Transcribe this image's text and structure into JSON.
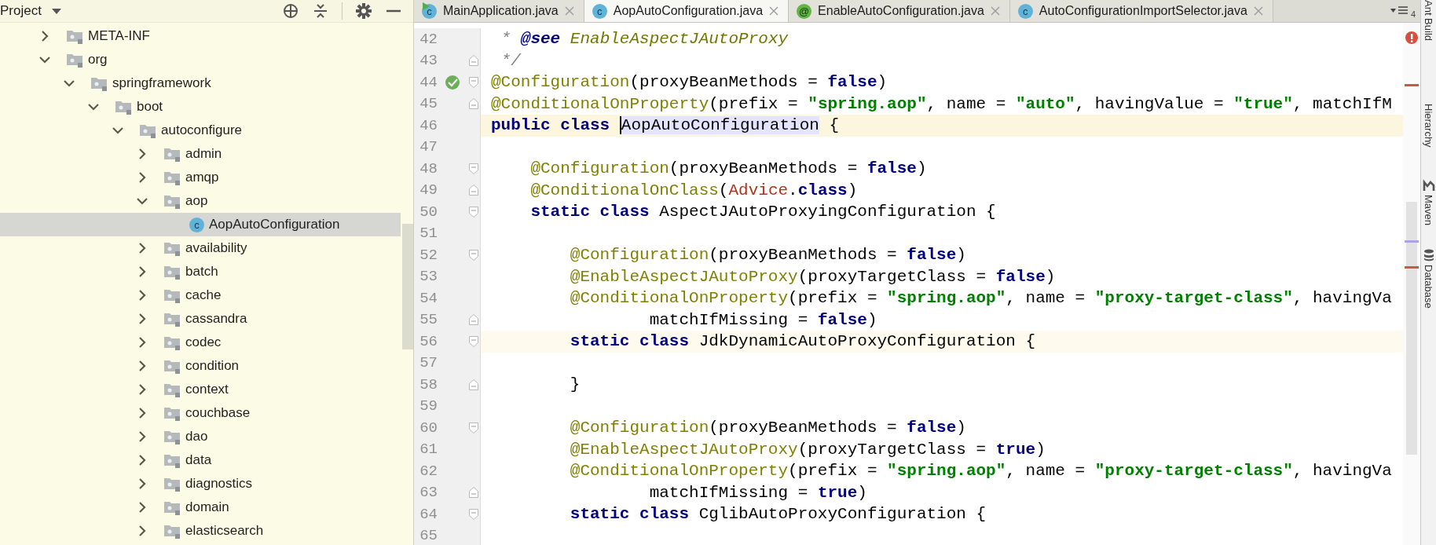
{
  "project_panel": {
    "title": "Project",
    "tree": [
      {
        "label": "META-INF",
        "kind": "folder",
        "expanded": false,
        "selected": false
      },
      {
        "label": "org",
        "kind": "folder",
        "expanded": true,
        "selected": false,
        "children": [
          {
            "label": "springframework",
            "kind": "folder",
            "expanded": true,
            "selected": false,
            "children": [
              {
                "label": "boot",
                "kind": "folder",
                "expanded": true,
                "selected": false,
                "children": [
                  {
                    "label": "autoconfigure",
                    "kind": "folder",
                    "expanded": true,
                    "selected": false,
                    "children": [
                      {
                        "label": "admin",
                        "kind": "folder",
                        "expanded": false,
                        "selected": false
                      },
                      {
                        "label": "amqp",
                        "kind": "folder",
                        "expanded": false,
                        "selected": false
                      },
                      {
                        "label": "aop",
                        "kind": "folder",
                        "expanded": true,
                        "selected": false,
                        "children": [
                          {
                            "label": "AopAutoConfiguration",
                            "kind": "class",
                            "badge": "c",
                            "selected": true
                          }
                        ]
                      },
                      {
                        "label": "availability",
                        "kind": "folder",
                        "expanded": false,
                        "selected": false
                      },
                      {
                        "label": "batch",
                        "kind": "folder",
                        "expanded": false,
                        "selected": false
                      },
                      {
                        "label": "cache",
                        "kind": "folder",
                        "expanded": false,
                        "selected": false
                      },
                      {
                        "label": "cassandra",
                        "kind": "folder",
                        "expanded": false,
                        "selected": false
                      },
                      {
                        "label": "codec",
                        "kind": "folder",
                        "expanded": false,
                        "selected": false
                      },
                      {
                        "label": "condition",
                        "kind": "folder",
                        "expanded": false,
                        "selected": false
                      },
                      {
                        "label": "context",
                        "kind": "folder",
                        "expanded": false,
                        "selected": false
                      },
                      {
                        "label": "couchbase",
                        "kind": "folder",
                        "expanded": false,
                        "selected": false
                      },
                      {
                        "label": "dao",
                        "kind": "folder",
                        "expanded": false,
                        "selected": false
                      },
                      {
                        "label": "data",
                        "kind": "folder",
                        "expanded": false,
                        "selected": false
                      },
                      {
                        "label": "diagnostics",
                        "kind": "folder",
                        "expanded": false,
                        "selected": false
                      },
                      {
                        "label": "domain",
                        "kind": "folder",
                        "expanded": false,
                        "selected": false
                      },
                      {
                        "label": "elasticsearch",
                        "kind": "folder",
                        "expanded": false,
                        "selected": false
                      }
                    ]
                  }
                ]
              }
            ]
          }
        ]
      }
    ]
  },
  "tabs": [
    {
      "label": "MainApplication.java",
      "kind": "class",
      "badge": "c",
      "runnable": true,
      "selected": false
    },
    {
      "label": "AopAutoConfiguration.java",
      "kind": "class",
      "badge": "c",
      "runnable": false,
      "selected": true
    },
    {
      "label": "EnableAutoConfiguration.java",
      "kind": "annotation",
      "badge": "@",
      "runnable": false,
      "selected": false
    },
    {
      "label": "AutoConfigurationImportSelector.java",
      "kind": "class",
      "badge": "c",
      "runnable": false,
      "selected": false
    }
  ],
  "tab_overflow_count": "4",
  "editor": {
    "lines": [
      {
        "number": "42",
        "tokens": [
          {
            "kind": "comment",
            "text": " * "
          },
          {
            "kind": "doc-tag",
            "text": "@see"
          },
          {
            "kind": "doc-ref",
            "text": " EnableAspectJAutoProxy"
          }
        ]
      },
      {
        "number": "43",
        "fold_end": true,
        "tokens": [
          {
            "kind": "comment",
            "text": " */"
          }
        ]
      },
      {
        "number": "44",
        "fold_start": true,
        "bean_marker": true,
        "tokens": [
          {
            "kind": "annotation",
            "text": "@Configuration"
          },
          {
            "kind": "plain",
            "text": "(proxyBeanMethods = "
          },
          {
            "kind": "keyword",
            "text": "false"
          },
          {
            "kind": "plain",
            "text": ")"
          }
        ]
      },
      {
        "number": "45",
        "fold_end": true,
        "tokens": [
          {
            "kind": "annotation",
            "text": "@ConditionalOnProperty"
          },
          {
            "kind": "plain",
            "text": "(prefix = "
          },
          {
            "kind": "string",
            "text": "\"spring.aop\""
          },
          {
            "kind": "plain",
            "text": ", name = "
          },
          {
            "kind": "string",
            "text": "\"auto\""
          },
          {
            "kind": "plain",
            "text": ", havingValue = "
          },
          {
            "kind": "string",
            "text": "\"true\""
          },
          {
            "kind": "plain",
            "text": ", matchIfM"
          }
        ]
      },
      {
        "number": "46",
        "current_line": true,
        "tokens": [
          {
            "kind": "keyword",
            "text": "public class "
          },
          {
            "kind": "usage",
            "text": "AopAutoConfiguration"
          },
          {
            "kind": "plain",
            "text": " {"
          }
        ]
      },
      {
        "number": "47"
      },
      {
        "number": "48",
        "fold_start": true,
        "tokens": [
          {
            "kind": "annotation",
            "text": "    @Configuration"
          },
          {
            "kind": "plain",
            "text": "(proxyBeanMethods = "
          },
          {
            "kind": "keyword",
            "text": "false"
          },
          {
            "kind": "plain",
            "text": ")"
          }
        ]
      },
      {
        "number": "49",
        "fold_end": true,
        "tokens": [
          {
            "kind": "annotation",
            "text": "    @ConditionalOnClass"
          },
          {
            "kind": "plain",
            "text": "("
          },
          {
            "kind": "class-ref",
            "text": "Advice"
          },
          {
            "kind": "plain",
            "text": "."
          },
          {
            "kind": "keyword",
            "text": "class"
          },
          {
            "kind": "plain",
            "text": ")"
          }
        ]
      },
      {
        "number": "50",
        "fold_start": true,
        "tokens": [
          {
            "kind": "keyword",
            "text": "    static class"
          },
          {
            "kind": "plain",
            "text": " AspectJAutoProxyingConfiguration {"
          }
        ]
      },
      {
        "number": "51"
      },
      {
        "number": "52",
        "fold_start": true,
        "tokens": [
          {
            "kind": "annotation",
            "text": "        @Configuration"
          },
          {
            "kind": "plain",
            "text": "(proxyBeanMethods = "
          },
          {
            "kind": "keyword",
            "text": "false"
          },
          {
            "kind": "plain",
            "text": ")"
          }
        ]
      },
      {
        "number": "53",
        "tokens": [
          {
            "kind": "annotation",
            "text": "        @EnableAspectJAutoProxy"
          },
          {
            "kind": "plain",
            "text": "(proxyTargetClass = "
          },
          {
            "kind": "keyword",
            "text": "false"
          },
          {
            "kind": "plain",
            "text": ")"
          }
        ]
      },
      {
        "number": "54",
        "tokens": [
          {
            "kind": "annotation",
            "text": "        @ConditionalOnProperty"
          },
          {
            "kind": "plain",
            "text": "(prefix = "
          },
          {
            "kind": "string",
            "text": "\"spring.aop\""
          },
          {
            "kind": "plain",
            "text": ", name = "
          },
          {
            "kind": "string",
            "text": "\"proxy-target-class\""
          },
          {
            "kind": "plain",
            "text": ", havingVa"
          }
        ]
      },
      {
        "number": "55",
        "fold_end": true,
        "tokens": [
          {
            "kind": "plain",
            "text": "                matchIfMissing = "
          },
          {
            "kind": "keyword",
            "text": "false"
          },
          {
            "kind": "plain",
            "text": ")"
          }
        ]
      },
      {
        "number": "56",
        "fold_start": true,
        "hover": true,
        "tokens": [
          {
            "kind": "keyword",
            "text": "        static class"
          },
          {
            "kind": "plain",
            "text": " JdkDynamicAutoProxyConfiguration {"
          }
        ]
      },
      {
        "number": "57"
      },
      {
        "number": "58",
        "fold_end": true,
        "tokens": [
          {
            "kind": "plain",
            "text": "        }"
          }
        ]
      },
      {
        "number": "59"
      },
      {
        "number": "60",
        "fold_start": true,
        "tokens": [
          {
            "kind": "annotation",
            "text": "        @Configuration"
          },
          {
            "kind": "plain",
            "text": "(proxyBeanMethods = "
          },
          {
            "kind": "keyword",
            "text": "false"
          },
          {
            "kind": "plain",
            "text": ")"
          }
        ]
      },
      {
        "number": "61",
        "tokens": [
          {
            "kind": "annotation",
            "text": "        @EnableAspectJAutoProxy"
          },
          {
            "kind": "plain",
            "text": "(proxyTargetClass = "
          },
          {
            "kind": "keyword",
            "text": "true"
          },
          {
            "kind": "plain",
            "text": ")"
          }
        ]
      },
      {
        "number": "62",
        "tokens": [
          {
            "kind": "annotation",
            "text": "        @ConditionalOnProperty"
          },
          {
            "kind": "plain",
            "text": "(prefix = "
          },
          {
            "kind": "string",
            "text": "\"spring.aop\""
          },
          {
            "kind": "plain",
            "text": ", name = "
          },
          {
            "kind": "string",
            "text": "\"proxy-target-class\""
          },
          {
            "kind": "plain",
            "text": ", havingVa"
          }
        ]
      },
      {
        "number": "63",
        "fold_end": true,
        "tokens": [
          {
            "kind": "plain",
            "text": "                matchIfMissing = "
          },
          {
            "kind": "keyword",
            "text": "true"
          },
          {
            "kind": "plain",
            "text": ")"
          }
        ]
      },
      {
        "number": "64",
        "fold_start": true,
        "tokens": [
          {
            "kind": "keyword",
            "text": "        static class"
          },
          {
            "kind": "plain",
            "text": " CglibAutoProxyConfiguration {"
          }
        ]
      },
      {
        "number": "65"
      }
    ],
    "stripe_marks": [
      {
        "color": "#d0573f"
      },
      {
        "color": "#a9a4e8"
      },
      {
        "color": "#d0573f"
      }
    ]
  },
  "tool_windows": [
    {
      "label": "Ant Build",
      "kind": "plain"
    },
    {
      "label": "Hierarchy",
      "kind": "plain"
    },
    {
      "label": "Maven",
      "kind": "maven"
    },
    {
      "label": "Database",
      "kind": "database"
    }
  ]
}
